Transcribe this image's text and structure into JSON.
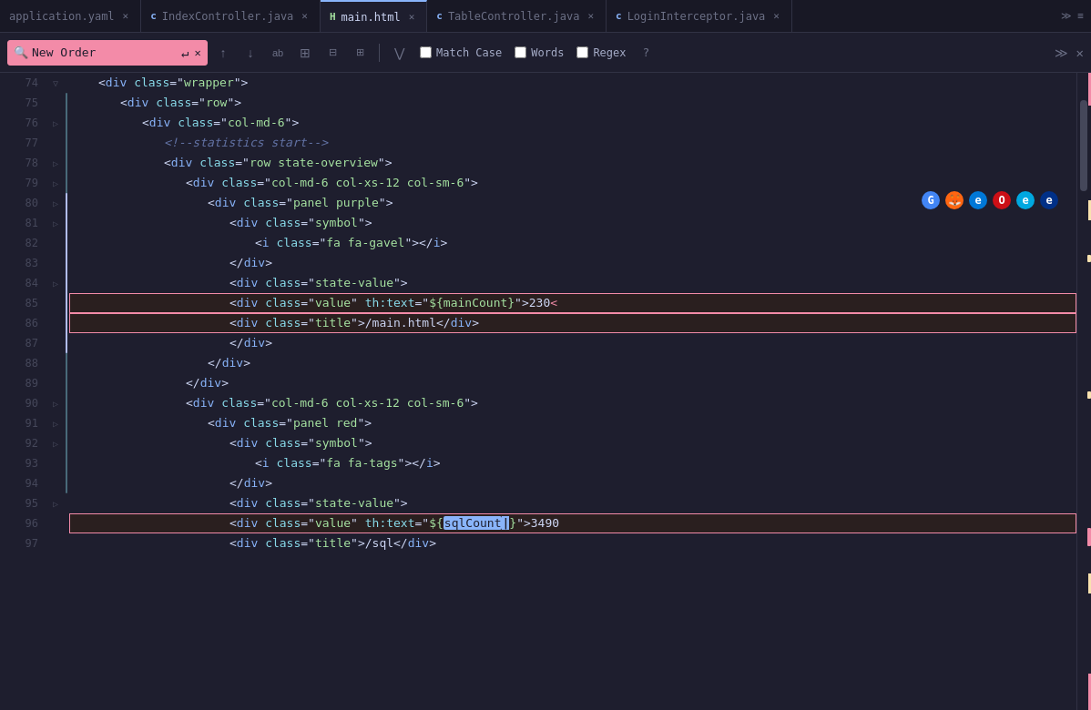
{
  "tabs": [
    {
      "id": "application-yaml",
      "label": "application.yaml",
      "icon": "file",
      "active": false,
      "modified": false
    },
    {
      "id": "index-controller",
      "label": "IndexController.java",
      "icon": "c",
      "active": false,
      "modified": false
    },
    {
      "id": "main-html",
      "label": "main.html",
      "icon": "h",
      "active": true,
      "modified": false
    },
    {
      "id": "table-controller",
      "label": "TableController.java",
      "icon": "c",
      "active": false,
      "modified": false
    },
    {
      "id": "login-interceptor",
      "label": "LoginInterceptor.java",
      "icon": "c",
      "active": false,
      "modified": false
    }
  ],
  "search": {
    "query": "New Order",
    "placeholder": "New Order",
    "match_case_label": "Match Case",
    "words_label": "Words",
    "regex_label": "Regex",
    "help_label": "?"
  },
  "lines": [
    {
      "num": 74,
      "content": "<div class=\"wrapper\">",
      "indent": 1
    },
    {
      "num": 75,
      "content": "<div class=\"row\">",
      "indent": 2
    },
    {
      "num": 76,
      "content": "<div class=\"col-md-6\">",
      "indent": 3
    },
    {
      "num": 77,
      "content": "<!--statistics start-->",
      "indent": 4,
      "comment": true
    },
    {
      "num": 78,
      "content": "<div class=\"row state-overview\">",
      "indent": 4
    },
    {
      "num": 79,
      "content": "<div class=\"col-md-6 col-xs-12 col-sm-6\">",
      "indent": 5
    },
    {
      "num": 80,
      "content": "<div class=\"panel purple\">",
      "indent": 6
    },
    {
      "num": 81,
      "content": "<div class=\"symbol\">",
      "indent": 7
    },
    {
      "num": 82,
      "content": "<i class=\"fa fa-gavel\"></i>",
      "indent": 7
    },
    {
      "num": 83,
      "content": "</div>",
      "indent": 7
    },
    {
      "num": 84,
      "content": "<div class=\"state-value\">",
      "indent": 7
    },
    {
      "num": 85,
      "content": "<div class=\"value\" th:text=\"${mainCount}\">230<",
      "indent": 7,
      "highlight": true
    },
    {
      "num": 86,
      "content": "<div class=\"title\">/main.html</div>",
      "indent": 7,
      "highlight": true
    },
    {
      "num": 87,
      "content": "</div>",
      "indent": 7
    },
    {
      "num": 88,
      "content": "</div>",
      "indent": 6
    },
    {
      "num": 89,
      "content": "</div>",
      "indent": 5
    },
    {
      "num": 90,
      "content": "<div class=\"col-md-6 col-xs-12 col-sm-6\">",
      "indent": 5
    },
    {
      "num": 91,
      "content": "<div class=\"panel red\">",
      "indent": 6
    },
    {
      "num": 92,
      "content": "<div class=\"symbol\">",
      "indent": 7
    },
    {
      "num": 93,
      "content": "<i class=\"fa fa-tags\"></i>",
      "indent": 7
    },
    {
      "num": 94,
      "content": "</div>",
      "indent": 7
    },
    {
      "num": 95,
      "content": "<div class=\"state-value\">",
      "indent": 7
    },
    {
      "num": 96,
      "content": "<div class=\"value\" th:text=\"${sqlCount}\">3490",
      "indent": 7,
      "highlight2": true
    },
    {
      "num": 97,
      "content": "<div class=\"title\">/sql</div>",
      "indent": 7
    }
  ]
}
